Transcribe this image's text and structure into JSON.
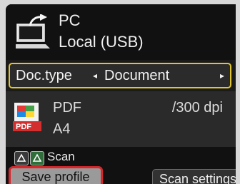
{
  "destination": {
    "name": "PC",
    "detail": "Local (USB)",
    "icon": "pc-icon"
  },
  "doc_type": {
    "label": "Doc.type",
    "value": "Document",
    "accent": "#e1c52e"
  },
  "scan_settings_summary": {
    "format": "PDF",
    "resolution": "/300 dpi",
    "paper": "A4",
    "icon": "pdf-file-icon"
  },
  "bottom": {
    "scan_label": "Scan",
    "mono_icon": "black-white-scan-icon",
    "color_icon": "color-scan-icon",
    "save_profile": "Save profile",
    "scan_settings": "Scan settings",
    "highlight_color": "#d9262b"
  }
}
